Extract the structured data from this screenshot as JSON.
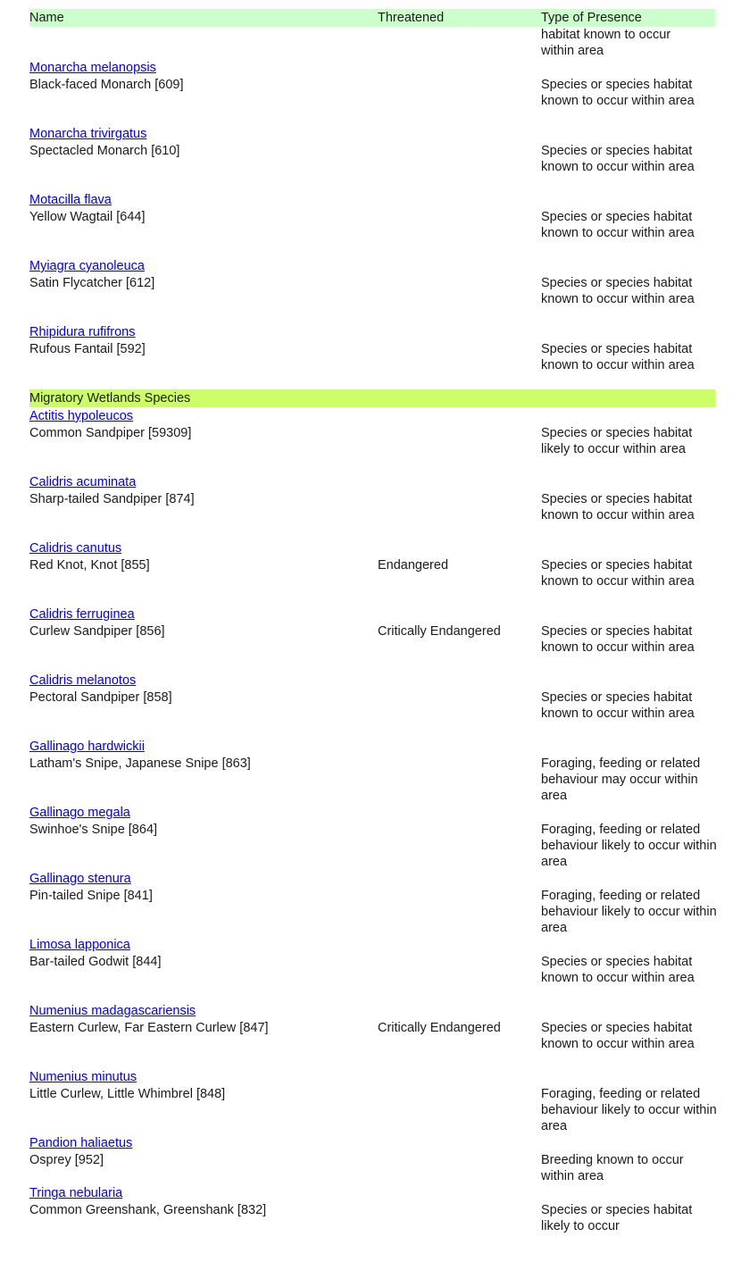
{
  "table": {
    "columns": [
      "Name",
      "Threatened",
      "Type of Presence"
    ],
    "continued_presence": "habitat known to occur within area",
    "groups": [
      {
        "title": "",
        "rows": [
          {
            "scientific": "Monarcha melanopsis",
            "common": "Black-faced Monarch [609]",
            "threatened": "",
            "presence": "Species or species habitat known to occur within area"
          },
          {
            "scientific": "Monarcha trivirgatus",
            "common": "Spectacled Monarch [610]",
            "threatened": "",
            "presence": "Species or species habitat known to occur within area"
          },
          {
            "scientific": "Motacilla flava",
            "common": "Yellow Wagtail [644]",
            "threatened": "",
            "presence": "Species or species habitat known to occur within area"
          },
          {
            "scientific": "Myiagra cyanoleuca",
            "common": "Satin Flycatcher [612]",
            "threatened": "",
            "presence": "Species or species habitat known to occur within area"
          },
          {
            "scientific": "Rhipidura rufifrons",
            "common": "Rufous Fantail [592]",
            "threatened": "",
            "presence": "Species or species habitat known to occur within area"
          }
        ]
      },
      {
        "title": "Migratory Wetlands Species",
        "rows": [
          {
            "scientific": "Actitis hypoleucos",
            "common": "Common Sandpiper [59309]",
            "threatened": "",
            "presence": "Species or species habitat likely to occur within area"
          },
          {
            "scientific": "Calidris acuminata",
            "common": "Sharp-tailed Sandpiper [874]",
            "threatened": "",
            "presence": "Species or species habitat known to occur within area"
          },
          {
            "scientific": "Calidris canutus",
            "common": "Red Knot, Knot [855]",
            "threatened": "Endangered",
            "presence": "Species or species habitat known to occur within area"
          },
          {
            "scientific": "Calidris ferruginea",
            "common": "Curlew Sandpiper [856]",
            "threatened": "Critically Endangered",
            "presence": "Species or species habitat known to occur within area"
          },
          {
            "scientific": "Calidris melanotos",
            "common": "Pectoral Sandpiper [858]",
            "threatened": "",
            "presence": "Species or species habitat known to occur within area"
          },
          {
            "scientific": "Gallinago hardwickii",
            "common": "Latham's Snipe, Japanese Snipe [863]",
            "threatened": "",
            "presence": "Foraging, feeding or related behaviour may occur within area"
          },
          {
            "scientific": "Gallinago megala",
            "common": "Swinhoe's Snipe [864]",
            "threatened": "",
            "presence": "Foraging, feeding or related behaviour likely to occur within area"
          },
          {
            "scientific": "Gallinago stenura",
            "common": "Pin-tailed Snipe [841]",
            "threatened": "",
            "presence": "Foraging, feeding or related behaviour likely to occur within area"
          },
          {
            "scientific": "Limosa lapponica",
            "common": "Bar-tailed Godwit [844]",
            "threatened": "",
            "presence": "Species or species habitat known to occur within area"
          },
          {
            "scientific": "Numenius madagascariensis",
            "common": "Eastern Curlew, Far Eastern Curlew [847]",
            "threatened": "Critically Endangered",
            "presence": "Species or species habitat known to occur within area"
          },
          {
            "scientific": "Numenius minutus",
            "common": "Little Curlew, Little Whimbrel [848]",
            "threatened": "",
            "presence": "Foraging, feeding or related behaviour likely to occur within area"
          },
          {
            "scientific": "Pandion haliaetus",
            "common": "Osprey [952]",
            "threatened": "",
            "presence": "Breeding known to occur within area"
          },
          {
            "scientific": "Tringa nebularia",
            "common": "Common Greenshank, Greenshank [832]",
            "threatened": "",
            "presence": "Species or species habitat likely to occur"
          }
        ]
      }
    ]
  }
}
